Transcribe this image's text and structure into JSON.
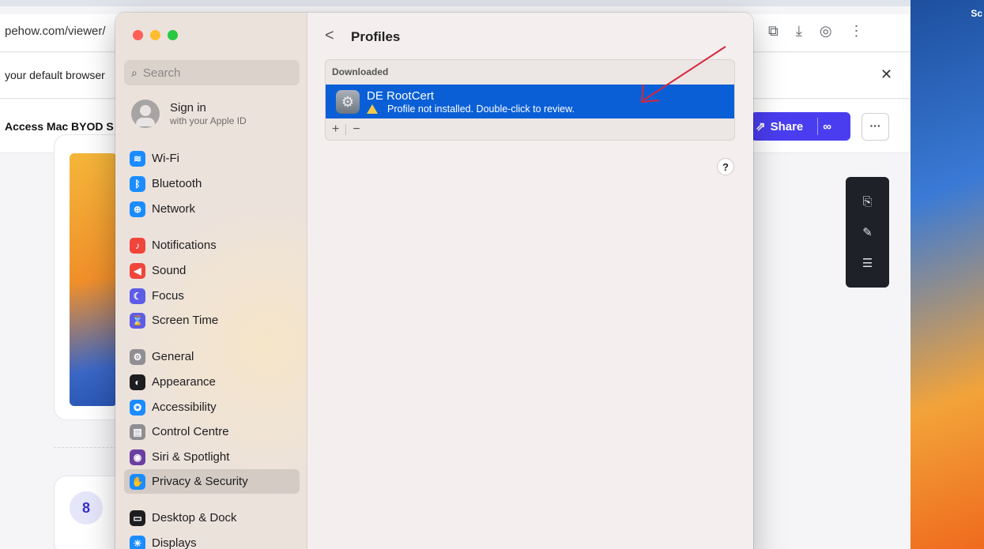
{
  "browser": {
    "url": "pehow.com/viewer/",
    "infobar_text": "your default browser",
    "infobar_close": "✕",
    "page_title": "Access Mac BYOD S",
    "share_label": "Share",
    "more_label": "···",
    "step_number": "8"
  },
  "desktop": {
    "label": "Sc"
  },
  "settings": {
    "search_placeholder": "Search",
    "signin_title": "Sign in",
    "signin_sub": "with your Apple ID",
    "sidebar": {
      "items": [
        {
          "label": "Wi-Fi",
          "icon": "wifi-icon",
          "color": "#1a8cff"
        },
        {
          "label": "Bluetooth",
          "icon": "bluetooth-icon",
          "color": "#1a8cff"
        },
        {
          "label": "Network",
          "icon": "globe-icon",
          "color": "#1a8cff"
        },
        {
          "label": "Notifications",
          "icon": "bell-icon",
          "color": "#f0453a"
        },
        {
          "label": "Sound",
          "icon": "speaker-icon",
          "color": "#f0453a"
        },
        {
          "label": "Focus",
          "icon": "moon-icon",
          "color": "#5e5ce6"
        },
        {
          "label": "Screen Time",
          "icon": "hourglass-icon",
          "color": "#5e5ce6"
        },
        {
          "label": "General",
          "icon": "gear-icon",
          "color": "#8e8e93"
        },
        {
          "label": "Appearance",
          "icon": "appearance-icon",
          "color": "#1d1d1f"
        },
        {
          "label": "Accessibility",
          "icon": "accessibility-icon",
          "color": "#1a8cff"
        },
        {
          "label": "Control Centre",
          "icon": "toggles-icon",
          "color": "#8e8e93"
        },
        {
          "label": "Siri & Spotlight",
          "icon": "siri-icon",
          "color": "#6b3fa0"
        },
        {
          "label": "Privacy & Security",
          "icon": "hand-icon",
          "color": "#1a8cff"
        },
        {
          "label": "Desktop & Dock",
          "icon": "dock-icon",
          "color": "#1d1d1f"
        },
        {
          "label": "Displays",
          "icon": "sun-icon",
          "color": "#1a8cff"
        }
      ]
    },
    "main": {
      "back": "<",
      "title": "Profiles",
      "section_header": "Downloaded",
      "profile_name": "DE RootCert",
      "profile_status": "Profile not installed. Double-click to review.",
      "add_label": "+",
      "remove_label": "−",
      "help_label": "?"
    }
  }
}
